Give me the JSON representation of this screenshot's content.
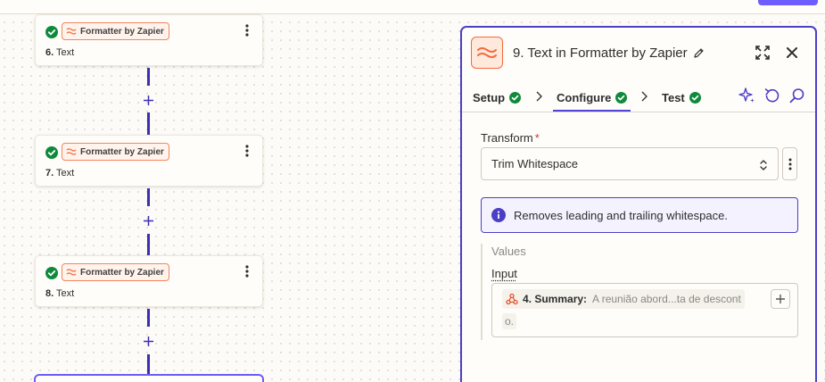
{
  "canvas": {
    "steps": [
      {
        "number": "6.",
        "title": "Text",
        "app": "Formatter by Zapier"
      },
      {
        "number": "7.",
        "title": "Text",
        "app": "Formatter by Zapier"
      },
      {
        "number": "8.",
        "title": "Text",
        "app": "Formatter by Zapier"
      }
    ]
  },
  "panel": {
    "title": "9. Text in Formatter by Zapier",
    "tabs": [
      {
        "label": "Setup"
      },
      {
        "label": "Configure"
      },
      {
        "label": "Test"
      }
    ],
    "transform": {
      "label": "Transform",
      "required_mark": "*",
      "value": "Trim Whitespace"
    },
    "info": "Removes leading and trailing whitespace.",
    "values": {
      "section_label": "Values",
      "input_label": "Input",
      "mapped_step": "4. Summary:",
      "mapped_value": "A reunião abord...ta de descont",
      "mapped_value_wrap": "o."
    }
  },
  "colors": {
    "accent": "#4b3fc6",
    "formatter_orange": "#f26b3b",
    "success_green": "#0f8a3c"
  }
}
